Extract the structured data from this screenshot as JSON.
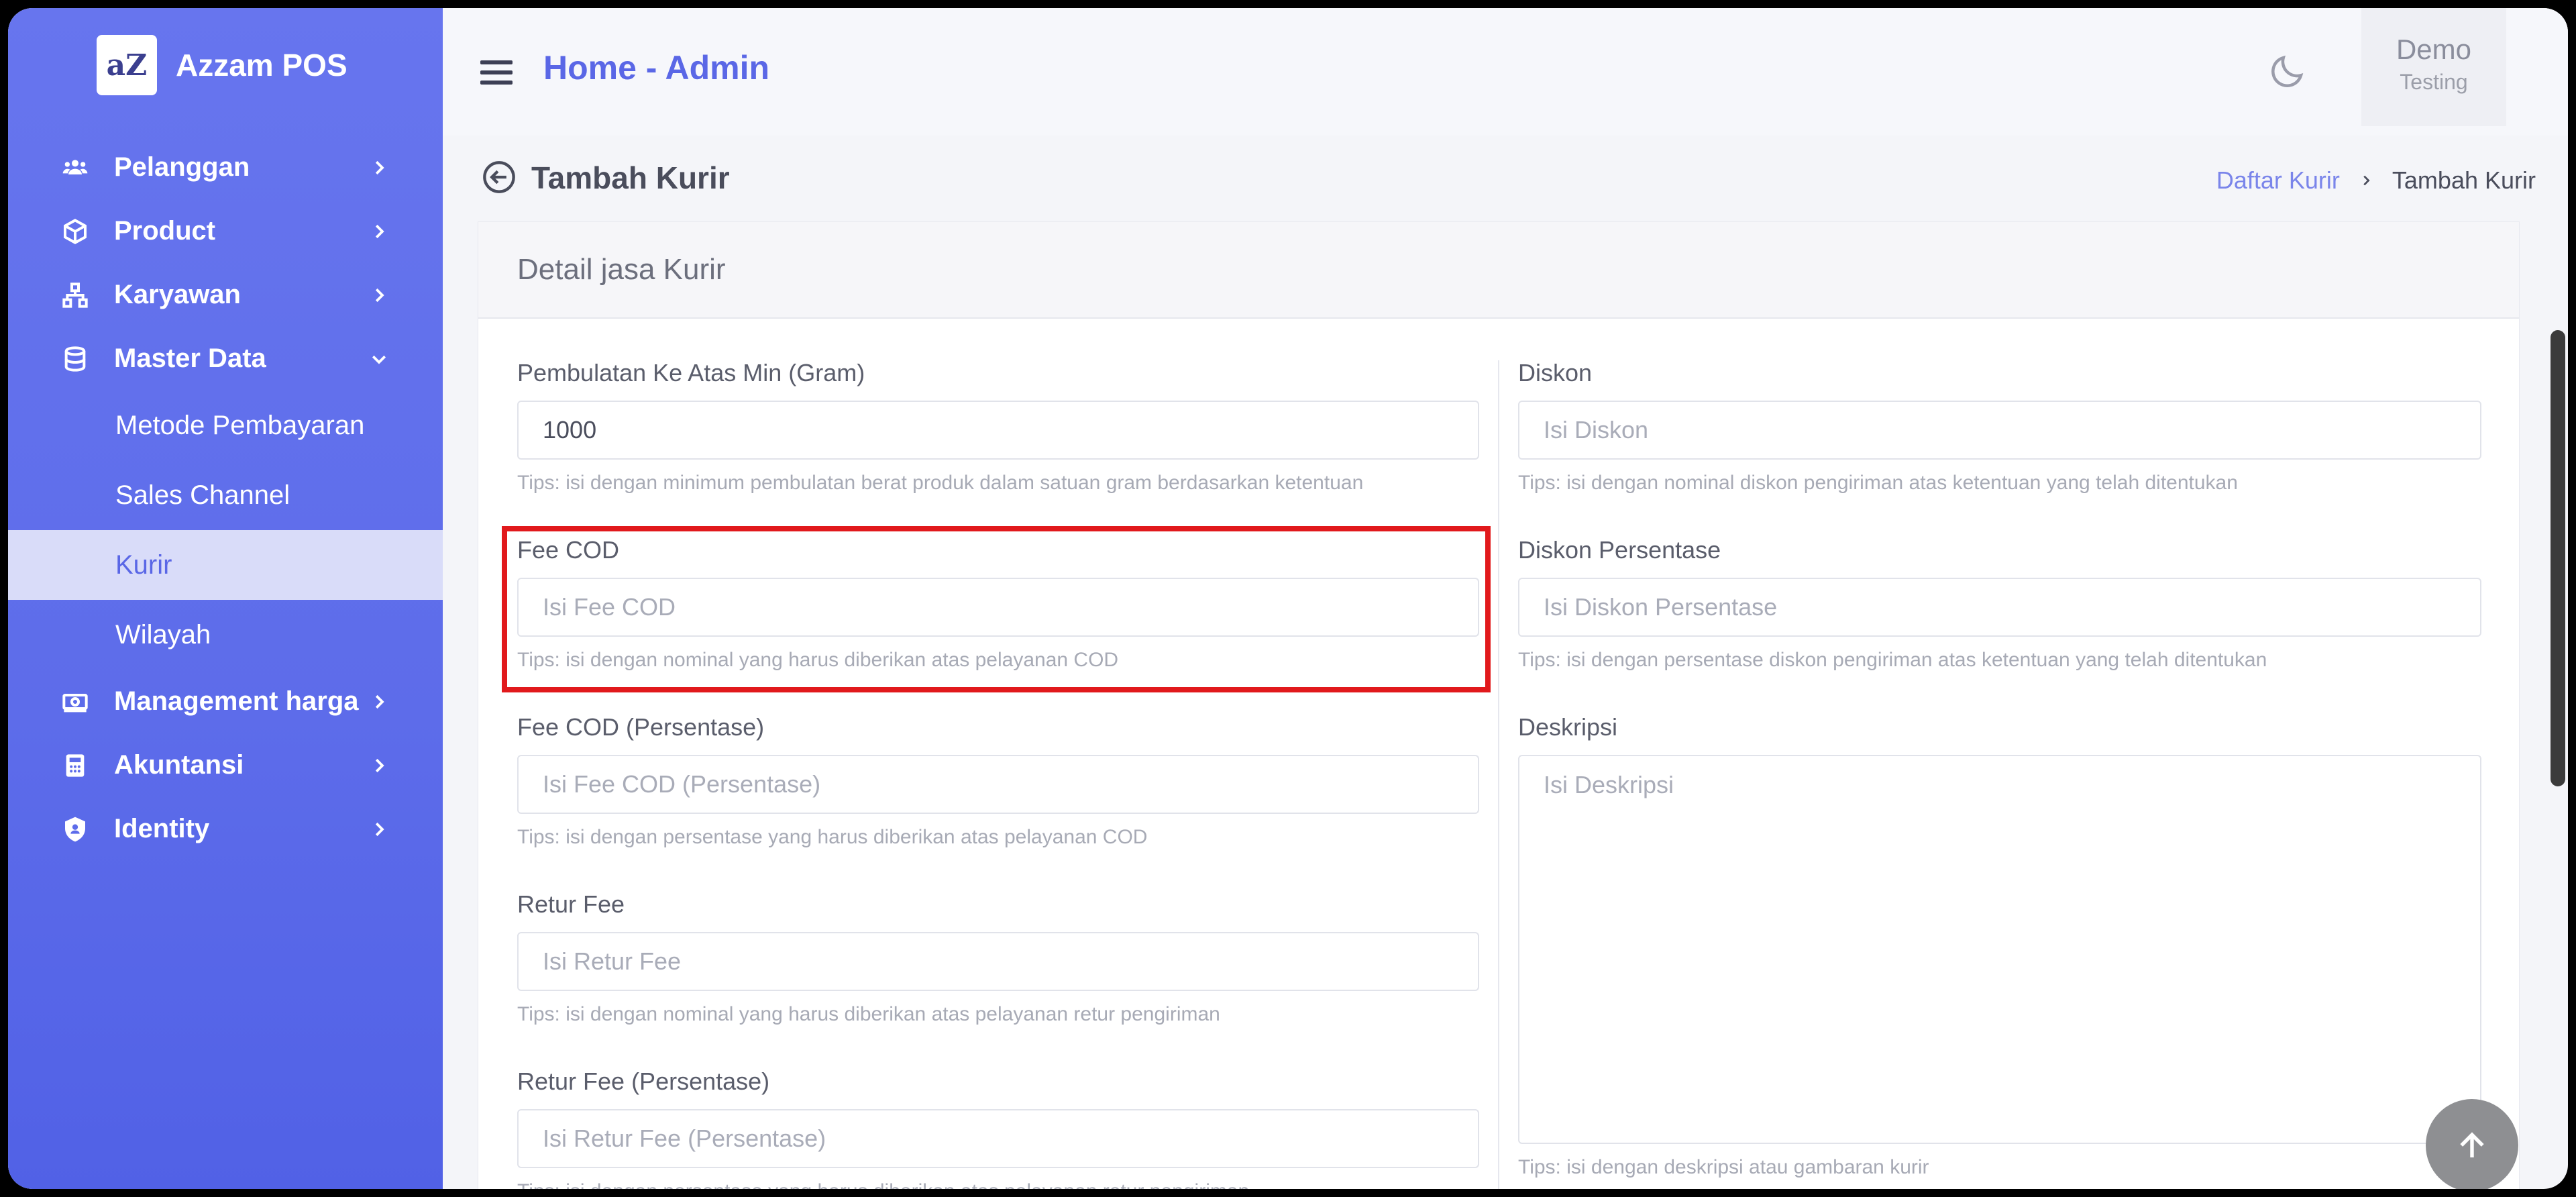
{
  "brand": {
    "logo_text": "aZ",
    "name": "Azzam POS"
  },
  "sidebar": {
    "items": [
      {
        "label": "Pelanggan",
        "icon": "users-icon"
      },
      {
        "label": "Product",
        "icon": "box-icon"
      },
      {
        "label": "Karyawan",
        "icon": "org-chart-icon"
      },
      {
        "label": "Master Data",
        "icon": "database-icon",
        "expanded": true,
        "children": [
          {
            "label": "Metode Pembayaran"
          },
          {
            "label": "Sales Channel"
          },
          {
            "label": "Kurir",
            "active": true
          },
          {
            "label": "Wilayah"
          }
        ]
      },
      {
        "label": "Management harga",
        "icon": "money-icon"
      },
      {
        "label": "Akuntansi",
        "icon": "calculator-icon"
      },
      {
        "label": "Identity",
        "icon": "shield-icon"
      }
    ]
  },
  "header": {
    "title": "Home - Admin",
    "user_name": "Demo",
    "user_role": "Testing"
  },
  "page": {
    "title": "Tambah Kurir",
    "breadcrumb": {
      "link": "Daftar Kurir",
      "current": "Tambah Kurir"
    }
  },
  "card": {
    "title": "Detail jasa Kurir",
    "left_fields": [
      {
        "label": "Pembulatan Ke Atas Min (Gram)",
        "value": "1000",
        "placeholder": "",
        "tip": "Tips: isi dengan minimum pembulatan berat produk dalam satuan gram berdasarkan ketentuan"
      },
      {
        "label": "Fee COD",
        "value": "",
        "placeholder": "Isi Fee COD",
        "tip": "Tips: isi dengan nominal yang harus diberikan atas pelayanan COD"
      },
      {
        "label": "Fee COD (Persentase)",
        "value": "",
        "placeholder": "Isi Fee COD (Persentase)",
        "tip": "Tips: isi dengan persentase yang harus diberikan atas pelayanan COD"
      },
      {
        "label": "Retur Fee",
        "value": "",
        "placeholder": "Isi Retur Fee",
        "tip": "Tips: isi dengan nominal yang harus diberikan atas pelayanan retur pengiriman"
      },
      {
        "label": "Retur Fee (Persentase)",
        "value": "",
        "placeholder": "Isi Retur Fee (Persentase)",
        "tip": "Tips: isi dengan persentase yang harus diberikan atas pelayanan retur pengiriman"
      }
    ],
    "right_fields": [
      {
        "label": "Diskon",
        "placeholder": "Isi Diskon",
        "tip": "Tips: isi dengan nominal diskon pengiriman atas ketentuan yang telah ditentukan"
      },
      {
        "label": "Diskon Persentase",
        "placeholder": "Isi Diskon Persentase",
        "tip": "Tips: isi dengan persentase diskon pengiriman atas ketentuan yang telah ditentukan"
      },
      {
        "label": "Deskripsi",
        "placeholder": "Isi Deskripsi",
        "tip": "Tips: isi dengan deskripsi atau gambaran kurir"
      }
    ]
  },
  "colors": {
    "primary": "#5a67e6",
    "highlight": "#e1191c",
    "sidebar": "#5d6cea"
  }
}
